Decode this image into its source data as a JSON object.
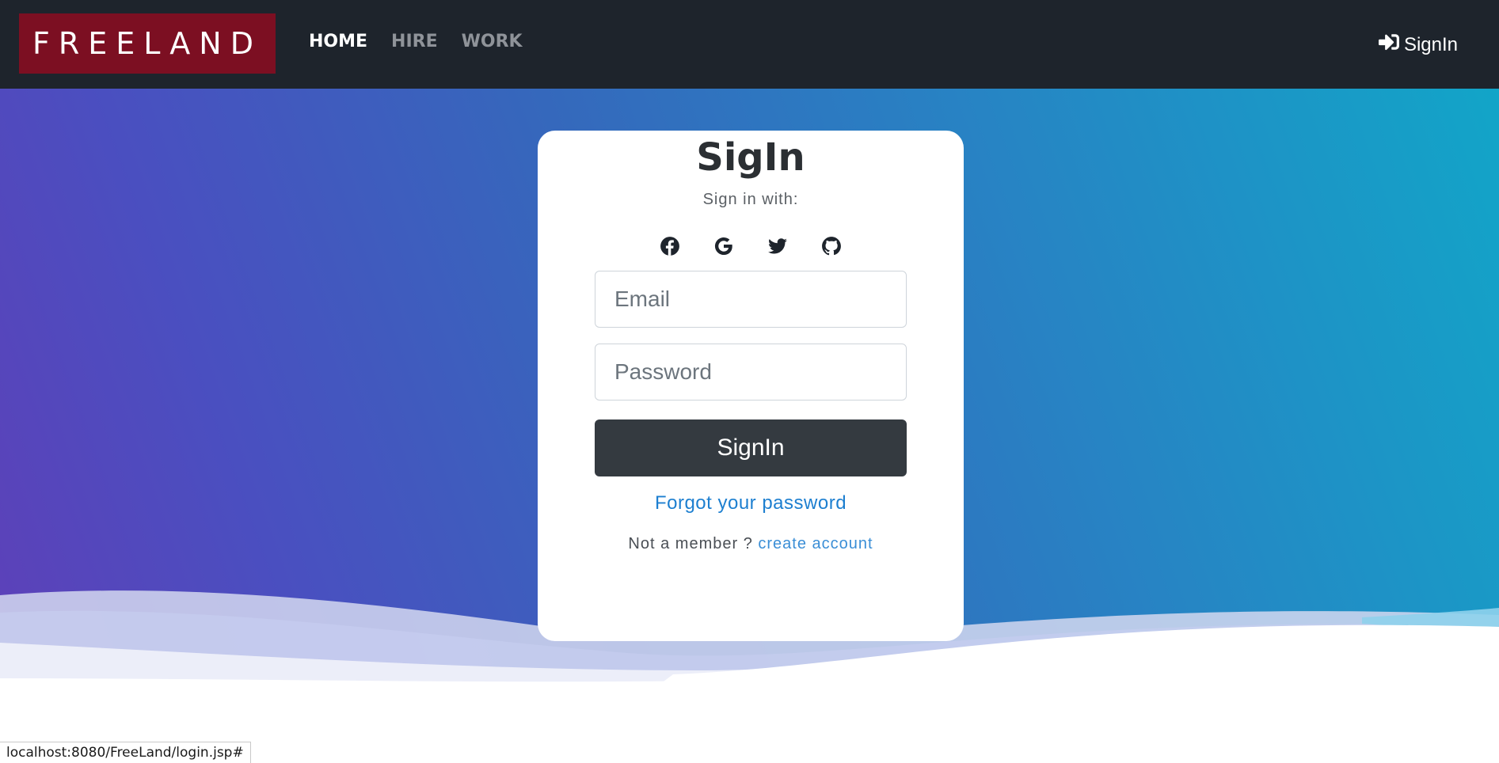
{
  "navbar": {
    "brand": "FREELAND",
    "links": [
      {
        "label": "HOME",
        "active": true
      },
      {
        "label": "HIRE",
        "active": false
      },
      {
        "label": "WORK",
        "active": false
      }
    ],
    "signin_label": "SignIn",
    "signin_icon": "sign-in-icon"
  },
  "card": {
    "title": "SigIn",
    "subtitle": "Sign in with:",
    "socials": [
      "facebook-icon",
      "google-icon",
      "twitter-icon",
      "github-icon"
    ],
    "email_placeholder": "Email",
    "password_placeholder": "Password",
    "submit_label": "SignIn",
    "forgot_label": "Forgot your password",
    "member_text": "Not a member ?",
    "create_label": "create account"
  },
  "status_url": "localhost:8080/FreeLand/login.jsp#",
  "colors": {
    "navbar": "#1e242c",
    "brand_bg": "#7c0f22",
    "button": "#343a40",
    "link": "#1d7fd0"
  }
}
